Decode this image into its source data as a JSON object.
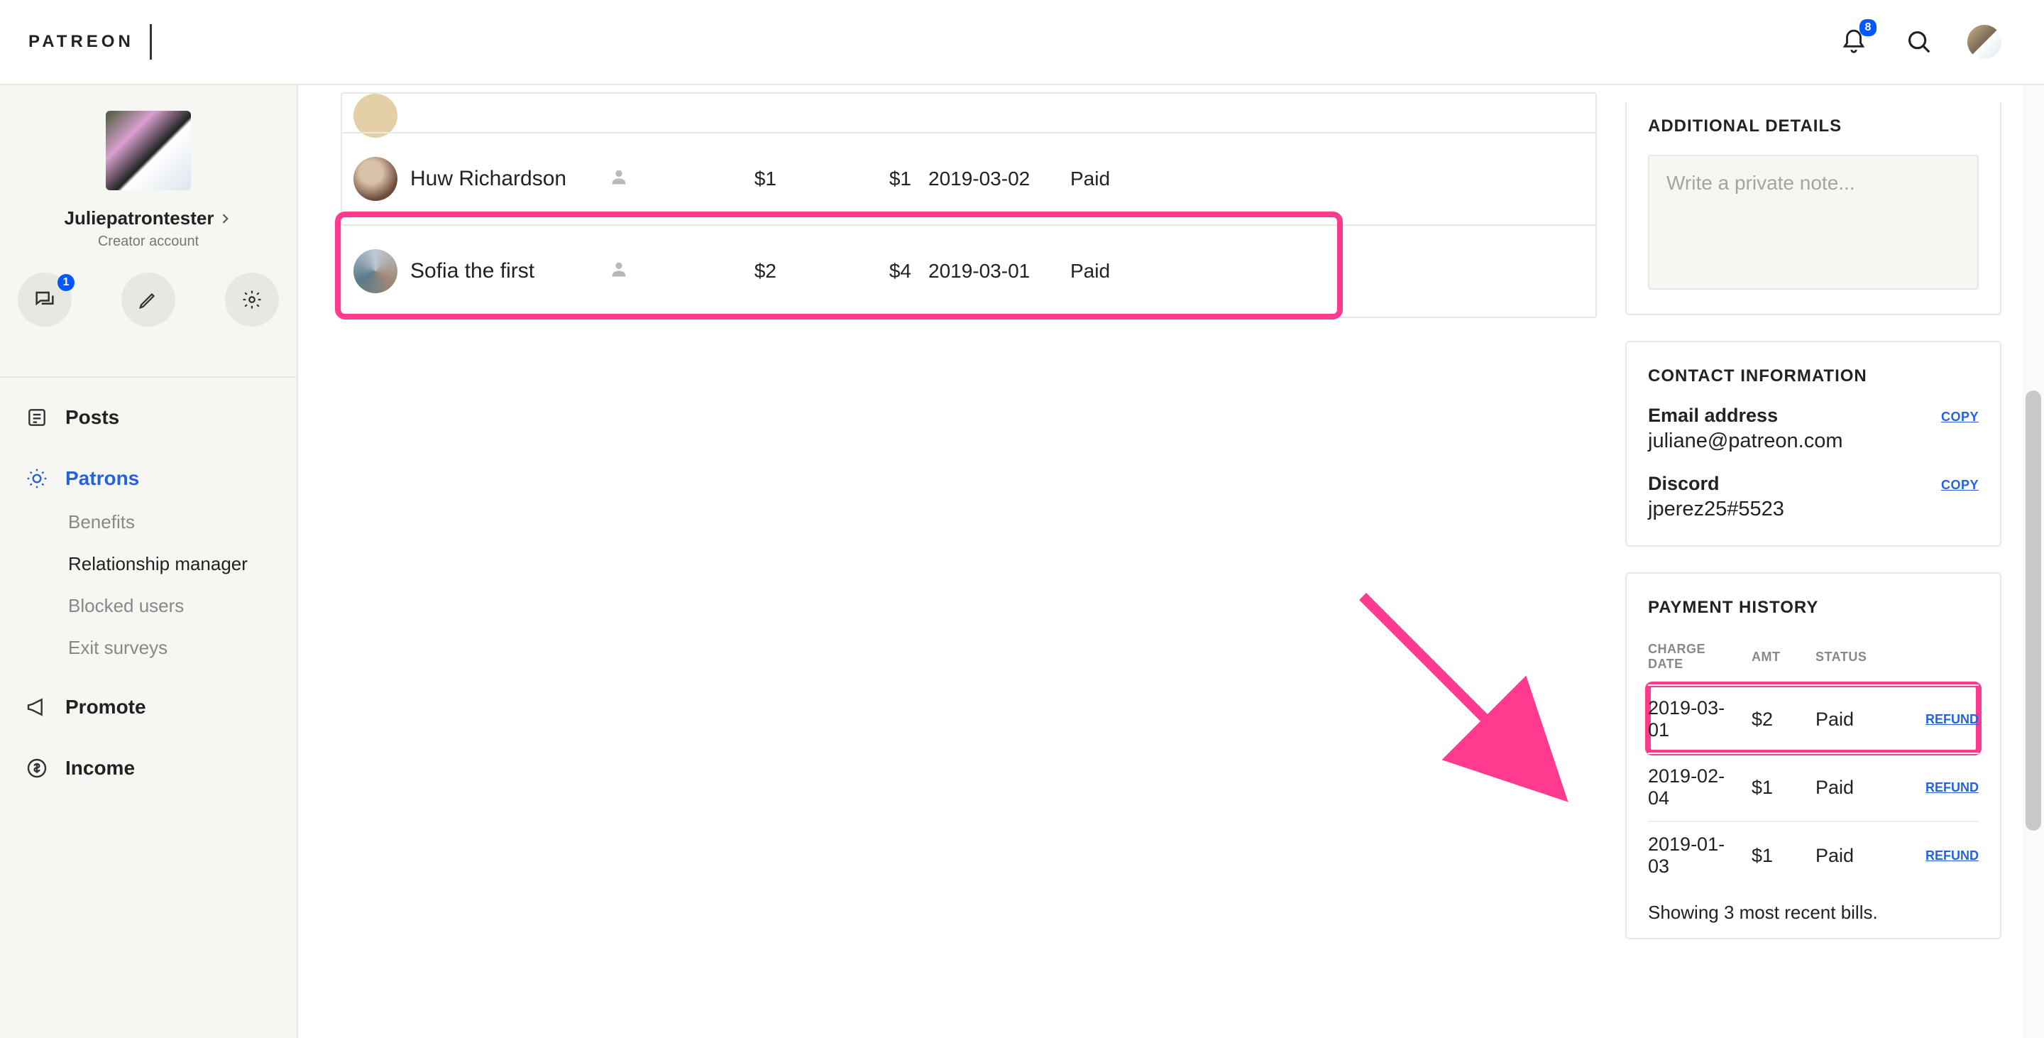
{
  "header": {
    "logo_text": "PATREON",
    "notification_count": "8"
  },
  "sidebar": {
    "profile_name": "Juliepatrontester",
    "profile_sub": "Creator account",
    "chat_badge": "1",
    "nav": {
      "posts": "Posts",
      "patrons": "Patrons",
      "benefits": "Benefits",
      "relationship_manager": "Relationship manager",
      "blocked_users": "Blocked users",
      "exit_surveys": "Exit surveys",
      "promote": "Promote",
      "income": "Income"
    }
  },
  "patron_table": {
    "rows": [
      {
        "name": "Huw Richardson",
        "amount": "$1",
        "lifetime": "$1",
        "date": "2019-03-02",
        "status": "Paid"
      },
      {
        "name": "Sofia the first",
        "amount": "$2",
        "lifetime": "$4",
        "date": "2019-03-01",
        "status": "Paid"
      }
    ]
  },
  "details": {
    "additional_title": "ADDITIONAL DETAILS",
    "note_placeholder": "Write a private note...",
    "contact_title": "CONTACT INFORMATION",
    "email_label": "Email address",
    "email_value": "juliane@patreon.com",
    "discord_label": "Discord",
    "discord_value": "jperez25#5523",
    "copy_label": "COPY"
  },
  "payment_history": {
    "title": "PAYMENT HISTORY",
    "head_date": "CHARGE DATE",
    "head_amt": "AMT",
    "head_status": "STATUS",
    "refund_label": "REFUND",
    "rows": [
      {
        "date": "2019-03-01",
        "amt": "$2",
        "status": "Paid"
      },
      {
        "date": "2019-02-04",
        "amt": "$1",
        "status": "Paid"
      },
      {
        "date": "2019-01-03",
        "amt": "$1",
        "status": "Paid"
      }
    ],
    "footer": "Showing 3 most recent bills."
  }
}
